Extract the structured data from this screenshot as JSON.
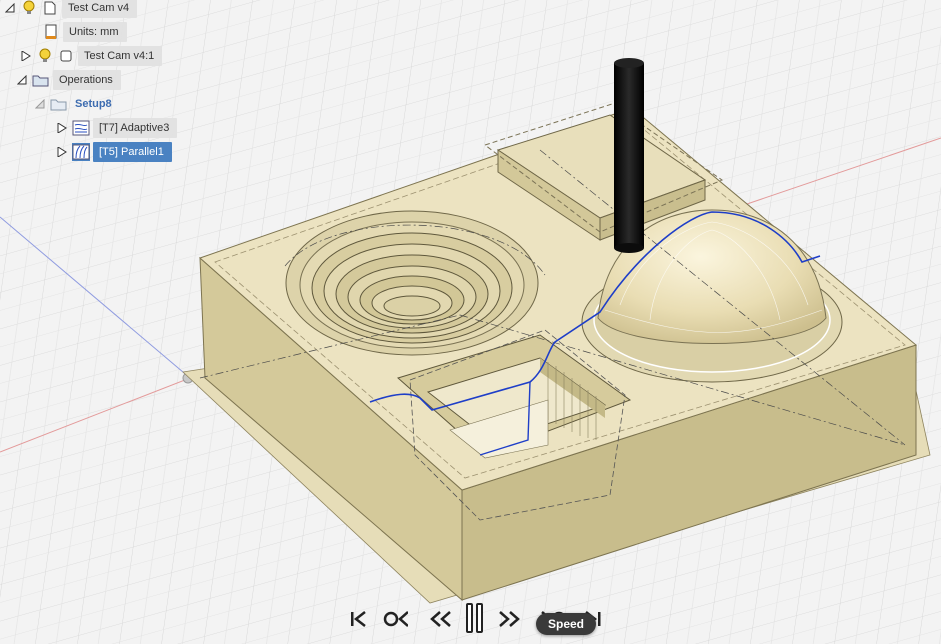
{
  "browser": {
    "root": {
      "label": "Test Cam v4",
      "icons": [
        "lightbulb-icon",
        "document-icon"
      ]
    },
    "units": {
      "label": "Units: mm"
    },
    "component": {
      "label": "Test Cam v4:1"
    },
    "operations": {
      "label": "Operations"
    },
    "setup": {
      "label": "Setup8"
    },
    "ops": [
      {
        "label": "[T7] Adaptive3",
        "icon": "adaptive-toolpath-icon",
        "selected": false
      },
      {
        "label": "[T5] Parallel1",
        "icon": "parallel-toolpath-icon",
        "selected": true
      }
    ]
  },
  "playback": {
    "buttons": [
      "skip-to-start",
      "step-back",
      "rewind",
      "pause",
      "fast-forward",
      "step-forward",
      "skip-to-end"
    ],
    "speed_tooltip": "Speed"
  },
  "colors": {
    "background": "#f3f3f3",
    "grid": "#d6d6d6",
    "stock_top": "#ece3c1",
    "stock_front": "#d7cc9f",
    "stock_side": "#c7bc8d",
    "tool": "#111111",
    "toolpath": "#1e3ec8",
    "axis_red": "#e07a7a",
    "axis_blue": "#7a8ae0",
    "selection": "#4a82c2"
  }
}
